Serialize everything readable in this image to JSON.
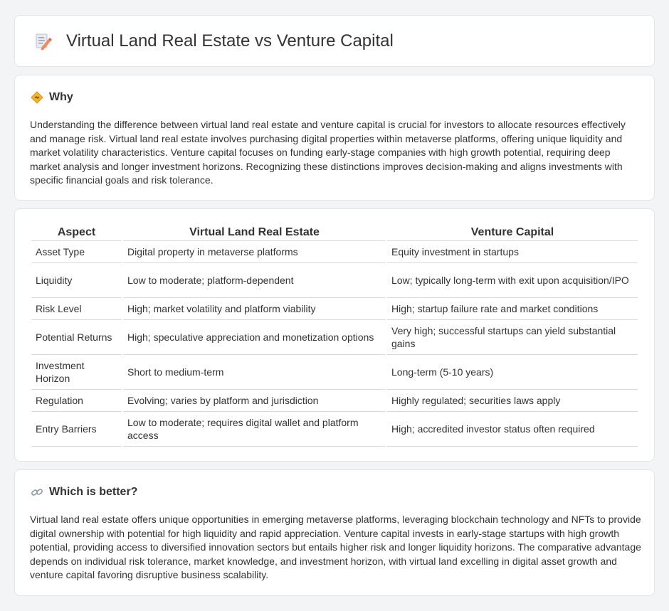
{
  "header": {
    "title": "Virtual Land Real Estate vs Venture Capital",
    "icon": "edit-document-icon"
  },
  "why": {
    "icon": "diamond-sign-icon",
    "heading": "Why",
    "text": "Understanding the difference between virtual land real estate and venture capital is crucial for investors to allocate resources effectively and manage risk. Virtual land real estate involves purchasing digital properties within metaverse platforms, offering unique liquidity and market volatility characteristics. Venture capital focuses on funding early-stage companies with high growth potential, requiring deep market analysis and longer investment horizons. Recognizing these distinctions improves decision-making and aligns investments with specific financial goals and risk tolerance."
  },
  "table": {
    "headers": [
      "Aspect",
      "Virtual Land Real Estate",
      "Venture Capital"
    ],
    "rows": [
      [
        "Asset Type",
        "Digital property in metaverse platforms",
        "Equity investment in startups"
      ],
      [
        "Liquidity",
        "Low to moderate; platform-dependent",
        "Low; typically long-term with exit upon acquisition/IPO"
      ],
      [
        "Risk Level",
        "High; market volatility and platform viability",
        "High; startup failure rate and market conditions"
      ],
      [
        "Potential Returns",
        "High; speculative appreciation and monetization options",
        "Very high; successful startups can yield substantial gains"
      ],
      [
        "Investment Horizon",
        "Short to medium-term",
        "Long-term (5-10 years)"
      ],
      [
        "Regulation",
        "Evolving; varies by platform and jurisdiction",
        "Highly regulated; securities laws apply"
      ],
      [
        "Entry Barriers",
        "Low to moderate; requires digital wallet and platform access",
        "High; accredited investor status often required"
      ]
    ]
  },
  "better": {
    "icon": "link-icon",
    "heading": "Which is better?",
    "text": "Virtual land real estate offers unique opportunities in emerging metaverse platforms, leveraging blockchain technology and NFTs to provide digital ownership with potential for high liquidity and rapid appreciation. Venture capital invests in early-stage startups with high growth potential, providing access to diversified innovation sectors but entails higher risk and longer liquidity horizons. The comparative advantage depends on individual risk tolerance, market knowledge, and investment horizon, with virtual land excelling in digital asset growth and venture capital favoring disruptive business scalability."
  }
}
